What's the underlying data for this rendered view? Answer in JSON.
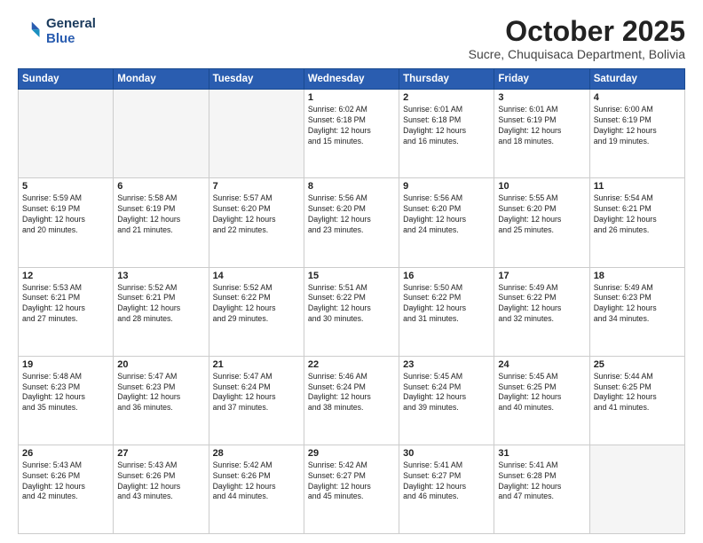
{
  "logo": {
    "line1": "General",
    "line2": "Blue"
  },
  "title": "October 2025",
  "subtitle": "Sucre, Chuquisaca Department, Bolivia",
  "weekdays": [
    "Sunday",
    "Monday",
    "Tuesday",
    "Wednesday",
    "Thursday",
    "Friday",
    "Saturday"
  ],
  "weeks": [
    [
      {
        "day": "",
        "info": ""
      },
      {
        "day": "",
        "info": ""
      },
      {
        "day": "",
        "info": ""
      },
      {
        "day": "1",
        "info": "Sunrise: 6:02 AM\nSunset: 6:18 PM\nDaylight: 12 hours\nand 15 minutes."
      },
      {
        "day": "2",
        "info": "Sunrise: 6:01 AM\nSunset: 6:18 PM\nDaylight: 12 hours\nand 16 minutes."
      },
      {
        "day": "3",
        "info": "Sunrise: 6:01 AM\nSunset: 6:19 PM\nDaylight: 12 hours\nand 18 minutes."
      },
      {
        "day": "4",
        "info": "Sunrise: 6:00 AM\nSunset: 6:19 PM\nDaylight: 12 hours\nand 19 minutes."
      }
    ],
    [
      {
        "day": "5",
        "info": "Sunrise: 5:59 AM\nSunset: 6:19 PM\nDaylight: 12 hours\nand 20 minutes."
      },
      {
        "day": "6",
        "info": "Sunrise: 5:58 AM\nSunset: 6:19 PM\nDaylight: 12 hours\nand 21 minutes."
      },
      {
        "day": "7",
        "info": "Sunrise: 5:57 AM\nSunset: 6:20 PM\nDaylight: 12 hours\nand 22 minutes."
      },
      {
        "day": "8",
        "info": "Sunrise: 5:56 AM\nSunset: 6:20 PM\nDaylight: 12 hours\nand 23 minutes."
      },
      {
        "day": "9",
        "info": "Sunrise: 5:56 AM\nSunset: 6:20 PM\nDaylight: 12 hours\nand 24 minutes."
      },
      {
        "day": "10",
        "info": "Sunrise: 5:55 AM\nSunset: 6:20 PM\nDaylight: 12 hours\nand 25 minutes."
      },
      {
        "day": "11",
        "info": "Sunrise: 5:54 AM\nSunset: 6:21 PM\nDaylight: 12 hours\nand 26 minutes."
      }
    ],
    [
      {
        "day": "12",
        "info": "Sunrise: 5:53 AM\nSunset: 6:21 PM\nDaylight: 12 hours\nand 27 minutes."
      },
      {
        "day": "13",
        "info": "Sunrise: 5:52 AM\nSunset: 6:21 PM\nDaylight: 12 hours\nand 28 minutes."
      },
      {
        "day": "14",
        "info": "Sunrise: 5:52 AM\nSunset: 6:22 PM\nDaylight: 12 hours\nand 29 minutes."
      },
      {
        "day": "15",
        "info": "Sunrise: 5:51 AM\nSunset: 6:22 PM\nDaylight: 12 hours\nand 30 minutes."
      },
      {
        "day": "16",
        "info": "Sunrise: 5:50 AM\nSunset: 6:22 PM\nDaylight: 12 hours\nand 31 minutes."
      },
      {
        "day": "17",
        "info": "Sunrise: 5:49 AM\nSunset: 6:22 PM\nDaylight: 12 hours\nand 32 minutes."
      },
      {
        "day": "18",
        "info": "Sunrise: 5:49 AM\nSunset: 6:23 PM\nDaylight: 12 hours\nand 34 minutes."
      }
    ],
    [
      {
        "day": "19",
        "info": "Sunrise: 5:48 AM\nSunset: 6:23 PM\nDaylight: 12 hours\nand 35 minutes."
      },
      {
        "day": "20",
        "info": "Sunrise: 5:47 AM\nSunset: 6:23 PM\nDaylight: 12 hours\nand 36 minutes."
      },
      {
        "day": "21",
        "info": "Sunrise: 5:47 AM\nSunset: 6:24 PM\nDaylight: 12 hours\nand 37 minutes."
      },
      {
        "day": "22",
        "info": "Sunrise: 5:46 AM\nSunset: 6:24 PM\nDaylight: 12 hours\nand 38 minutes."
      },
      {
        "day": "23",
        "info": "Sunrise: 5:45 AM\nSunset: 6:24 PM\nDaylight: 12 hours\nand 39 minutes."
      },
      {
        "day": "24",
        "info": "Sunrise: 5:45 AM\nSunset: 6:25 PM\nDaylight: 12 hours\nand 40 minutes."
      },
      {
        "day": "25",
        "info": "Sunrise: 5:44 AM\nSunset: 6:25 PM\nDaylight: 12 hours\nand 41 minutes."
      }
    ],
    [
      {
        "day": "26",
        "info": "Sunrise: 5:43 AM\nSunset: 6:26 PM\nDaylight: 12 hours\nand 42 minutes."
      },
      {
        "day": "27",
        "info": "Sunrise: 5:43 AM\nSunset: 6:26 PM\nDaylight: 12 hours\nand 43 minutes."
      },
      {
        "day": "28",
        "info": "Sunrise: 5:42 AM\nSunset: 6:26 PM\nDaylight: 12 hours\nand 44 minutes."
      },
      {
        "day": "29",
        "info": "Sunrise: 5:42 AM\nSunset: 6:27 PM\nDaylight: 12 hours\nand 45 minutes."
      },
      {
        "day": "30",
        "info": "Sunrise: 5:41 AM\nSunset: 6:27 PM\nDaylight: 12 hours\nand 46 minutes."
      },
      {
        "day": "31",
        "info": "Sunrise: 5:41 AM\nSunset: 6:28 PM\nDaylight: 12 hours\nand 47 minutes."
      },
      {
        "day": "",
        "info": ""
      }
    ]
  ]
}
